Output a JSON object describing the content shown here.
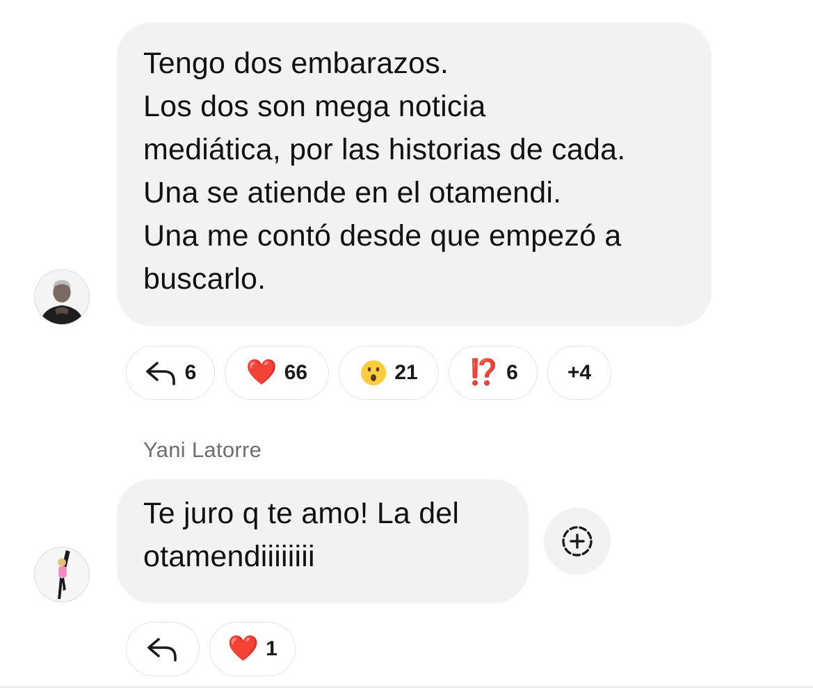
{
  "messages": [
    {
      "sender": "",
      "lines": [
        "Tengo dos embarazos.",
        "Los dos son mega noticia",
        "mediática, por las historias de cada.",
        "Una se atiende en el otamendi.",
        "Una me contó desde que empezó a",
        "buscarlo."
      ],
      "reactions": {
        "reply_count": "6",
        "heart_emoji": "❤️",
        "heart_count": "66",
        "wow_emoji": "😮",
        "wow_count": "21",
        "interrobang_emoji": "⁉️",
        "interrobang_count": "6",
        "more_label": "+4"
      }
    },
    {
      "sender": "Yani Latorre",
      "lines": [
        "Te juro q te amo! La del",
        "otamendiiiiiiii"
      ],
      "reactions": {
        "heart_emoji": "❤️",
        "heart_count": "1"
      }
    }
  ],
  "icons": {
    "reply": "reply-arrow-icon",
    "add_reaction": "add-reaction-icon",
    "avatar_1": "avatar-man-photo",
    "avatar_2": "avatar-woman-photo"
  },
  "colors": {
    "bubble_bg": "#f2f2f5",
    "sender_name": "#6d6d72",
    "heart": "#e0182d",
    "interrobang": "#e0302a"
  }
}
